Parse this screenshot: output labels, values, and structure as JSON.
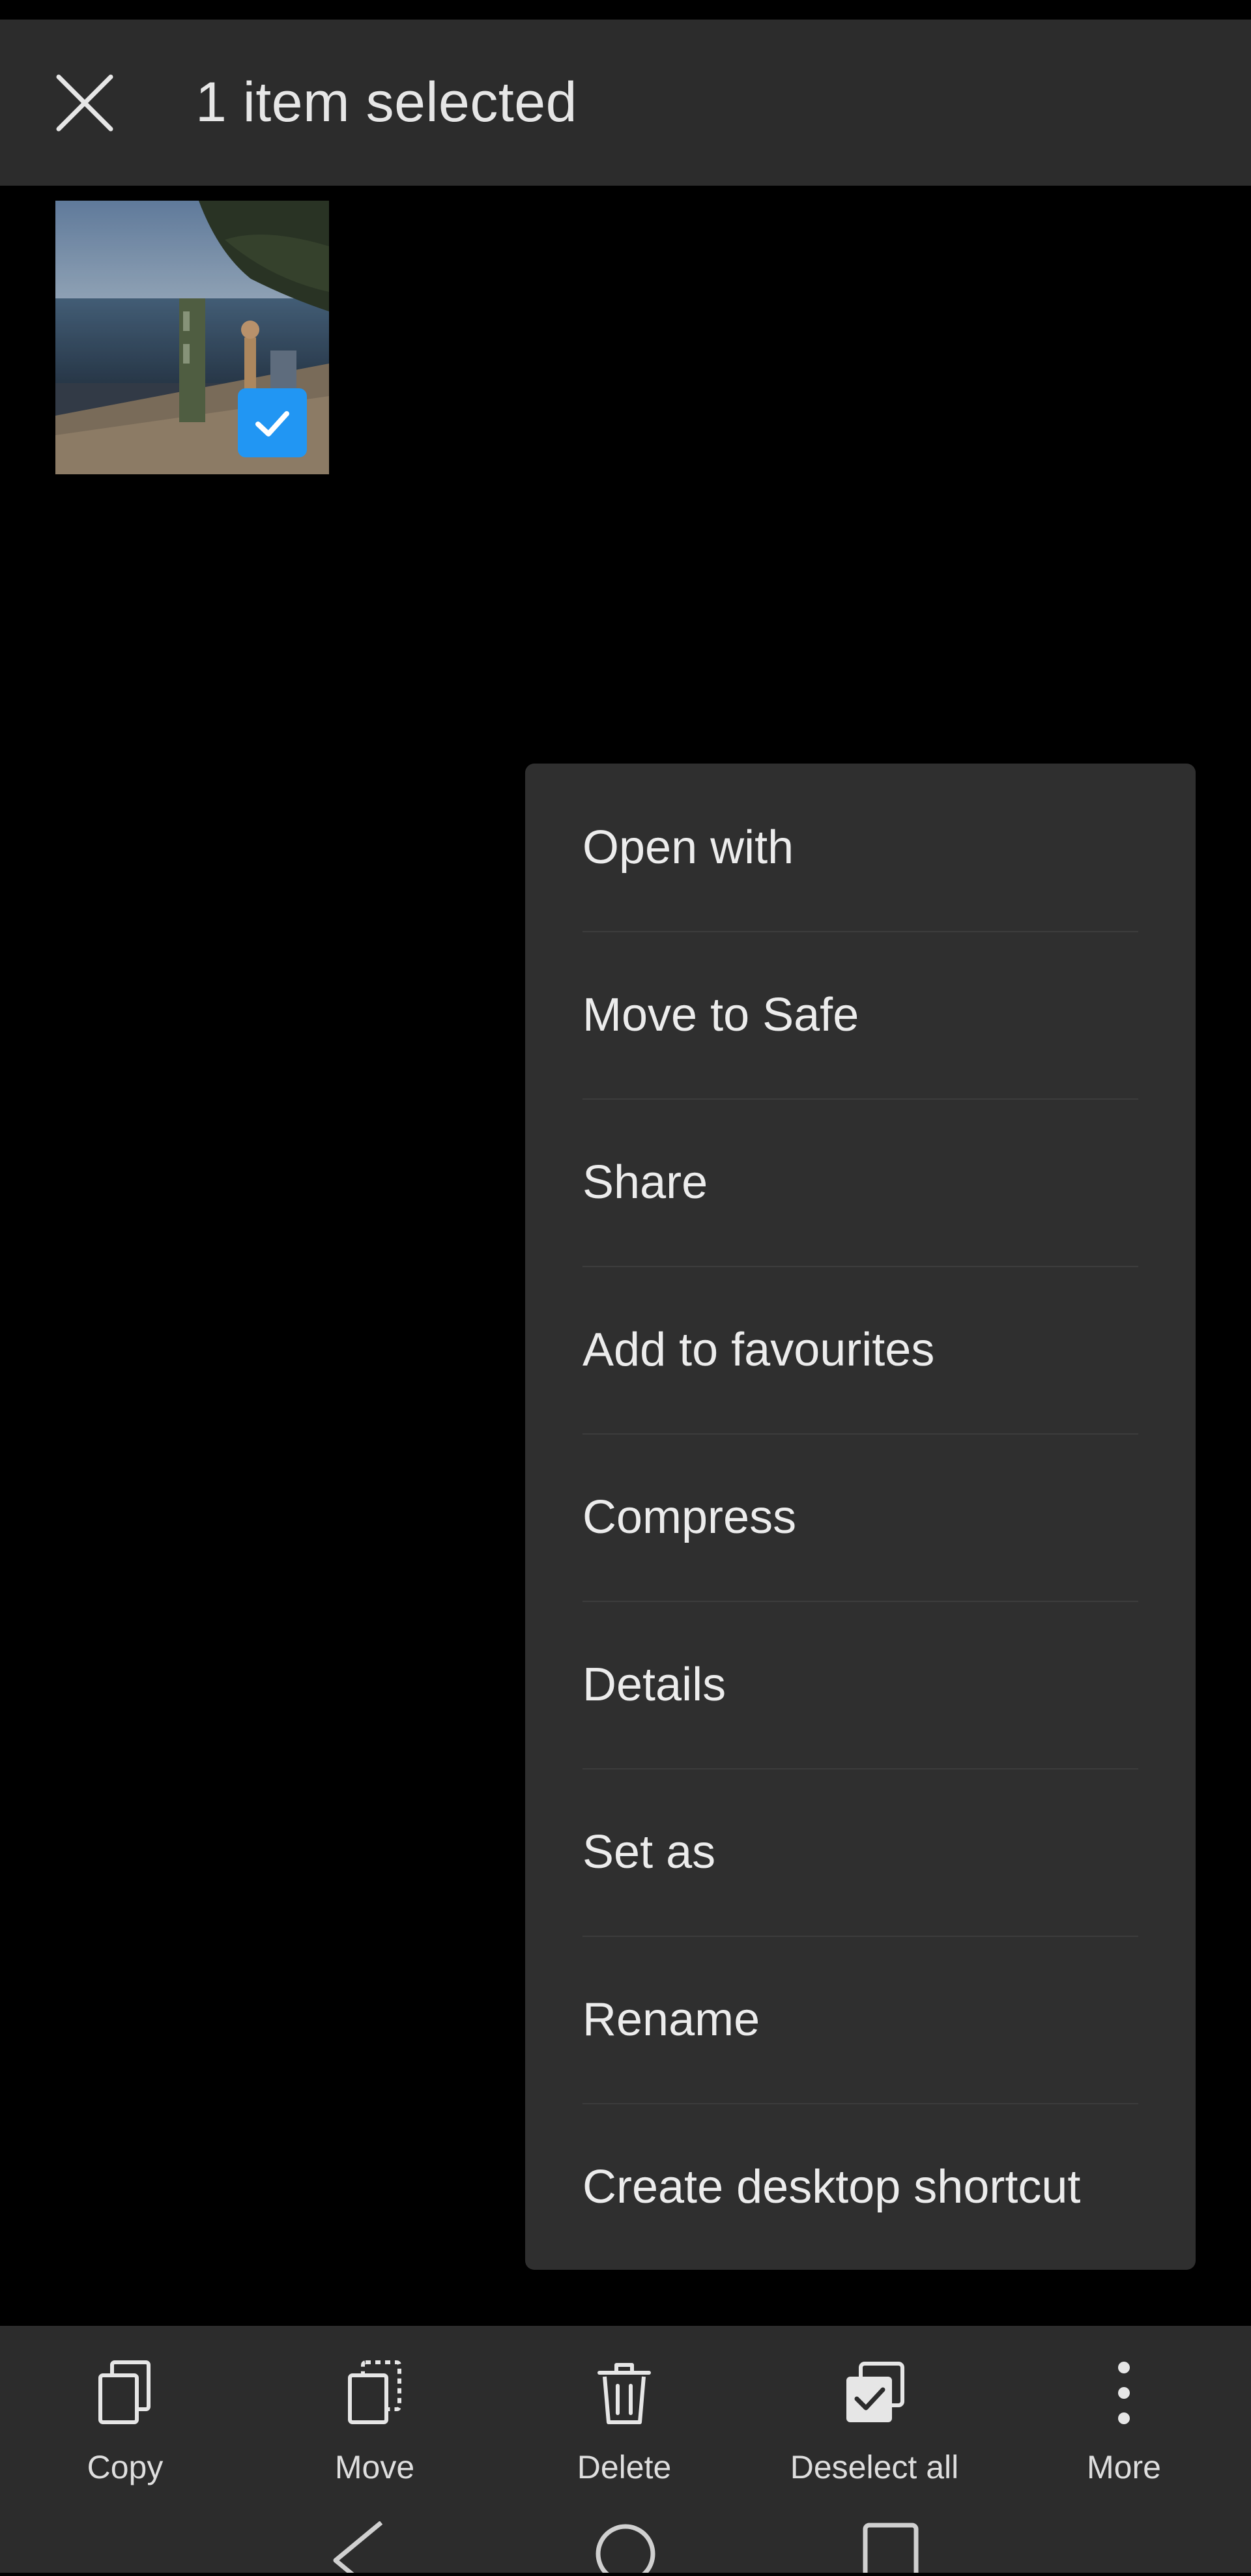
{
  "app_bar": {
    "title": "1 item selected",
    "close_icon": "close-icon"
  },
  "grid": {
    "items": [
      {
        "type": "image",
        "selected": true,
        "check_icon": "check-icon"
      }
    ]
  },
  "menu": {
    "items": [
      {
        "label": "Open with"
      },
      {
        "label": "Move to Safe"
      },
      {
        "label": "Share"
      },
      {
        "label": "Add to favourites"
      },
      {
        "label": "Compress"
      },
      {
        "label": "Details"
      },
      {
        "label": "Set as"
      },
      {
        "label": "Rename"
      },
      {
        "label": "Create desktop shortcut"
      }
    ]
  },
  "action_bar": {
    "items": [
      {
        "label": "Copy",
        "icon": "copy-icon"
      },
      {
        "label": "Move",
        "icon": "move-icon"
      },
      {
        "label": "Delete",
        "icon": "delete-icon"
      },
      {
        "label": "Deselect all",
        "icon": "deselect-all-icon"
      },
      {
        "label": "More",
        "icon": "more-icon"
      }
    ]
  },
  "system_nav": {
    "items": [
      {
        "icon": "back-icon"
      },
      {
        "icon": "home-icon"
      },
      {
        "icon": "recents-icon"
      }
    ]
  },
  "colors": {
    "background": "#000000",
    "bar": "#2c2c2c",
    "menu": "#2f2f2f",
    "accent": "#2196f3",
    "text": "#ececec"
  }
}
